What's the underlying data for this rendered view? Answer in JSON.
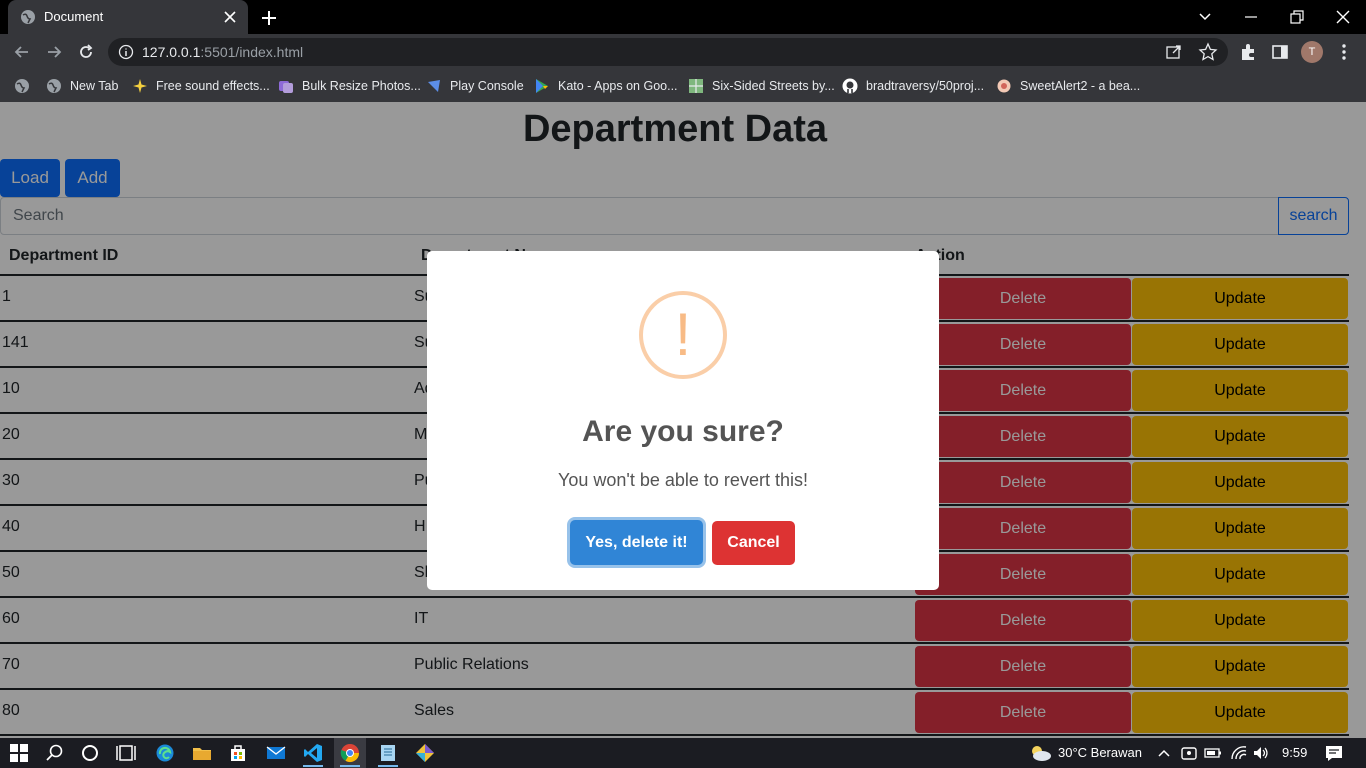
{
  "browser": {
    "tab_title": "Document",
    "url_host": "127.0.0.1",
    "url_rest": ":5501/index.html",
    "profile_initial": "T",
    "bookmarks": [
      {
        "label": "New Tab",
        "icon": "globe-icon"
      },
      {
        "label": "Free sound effects...",
        "icon": "sparkle-icon"
      },
      {
        "label": "Bulk Resize Photos...",
        "icon": "photos-icon"
      },
      {
        "label": "Play Console",
        "icon": "play-console-icon"
      },
      {
        "label": "Kato - Apps on Goo...",
        "icon": "google-play-icon"
      },
      {
        "label": "Six-Sided Streets by...",
        "icon": "map-icon"
      },
      {
        "label": "bradtraversy/50proj...",
        "icon": "github-icon"
      },
      {
        "label": "SweetAlert2 - a bea...",
        "icon": "sweetalert-icon"
      }
    ]
  },
  "page": {
    "title": "Department Data",
    "load_label": "Load",
    "add_label": "Add",
    "search_placeholder": "Search",
    "search_label": "search",
    "columns": [
      "Department ID",
      "Department Name",
      "Action"
    ],
    "delete_label": "Delete",
    "update_label": "Update",
    "rows": [
      {
        "id": "1",
        "name": "Su"
      },
      {
        "id": "141",
        "name": "Su"
      },
      {
        "id": "10",
        "name": "Ad"
      },
      {
        "id": "20",
        "name": "M"
      },
      {
        "id": "30",
        "name": "Pu"
      },
      {
        "id": "40",
        "name": "H"
      },
      {
        "id": "50",
        "name": "Sh"
      },
      {
        "id": "60",
        "name": "IT"
      },
      {
        "id": "70",
        "name": "Public Relations"
      },
      {
        "id": "80",
        "name": "Sales"
      }
    ]
  },
  "dialog": {
    "icon": "!",
    "title": "Are you sure?",
    "text": "You won't be able to revert this!",
    "confirm_label": "Yes, delete it!",
    "cancel_label": "Cancel"
  },
  "taskbar": {
    "weather": "30°C  Berawan",
    "time": "9:59"
  },
  "colors": {
    "primary": "#0d6efd",
    "danger": "#dc3545",
    "warning": "#ffc107",
    "confirm": "#3085d6",
    "cancel": "#dd3333",
    "warn_icon": "#f8bb86"
  }
}
